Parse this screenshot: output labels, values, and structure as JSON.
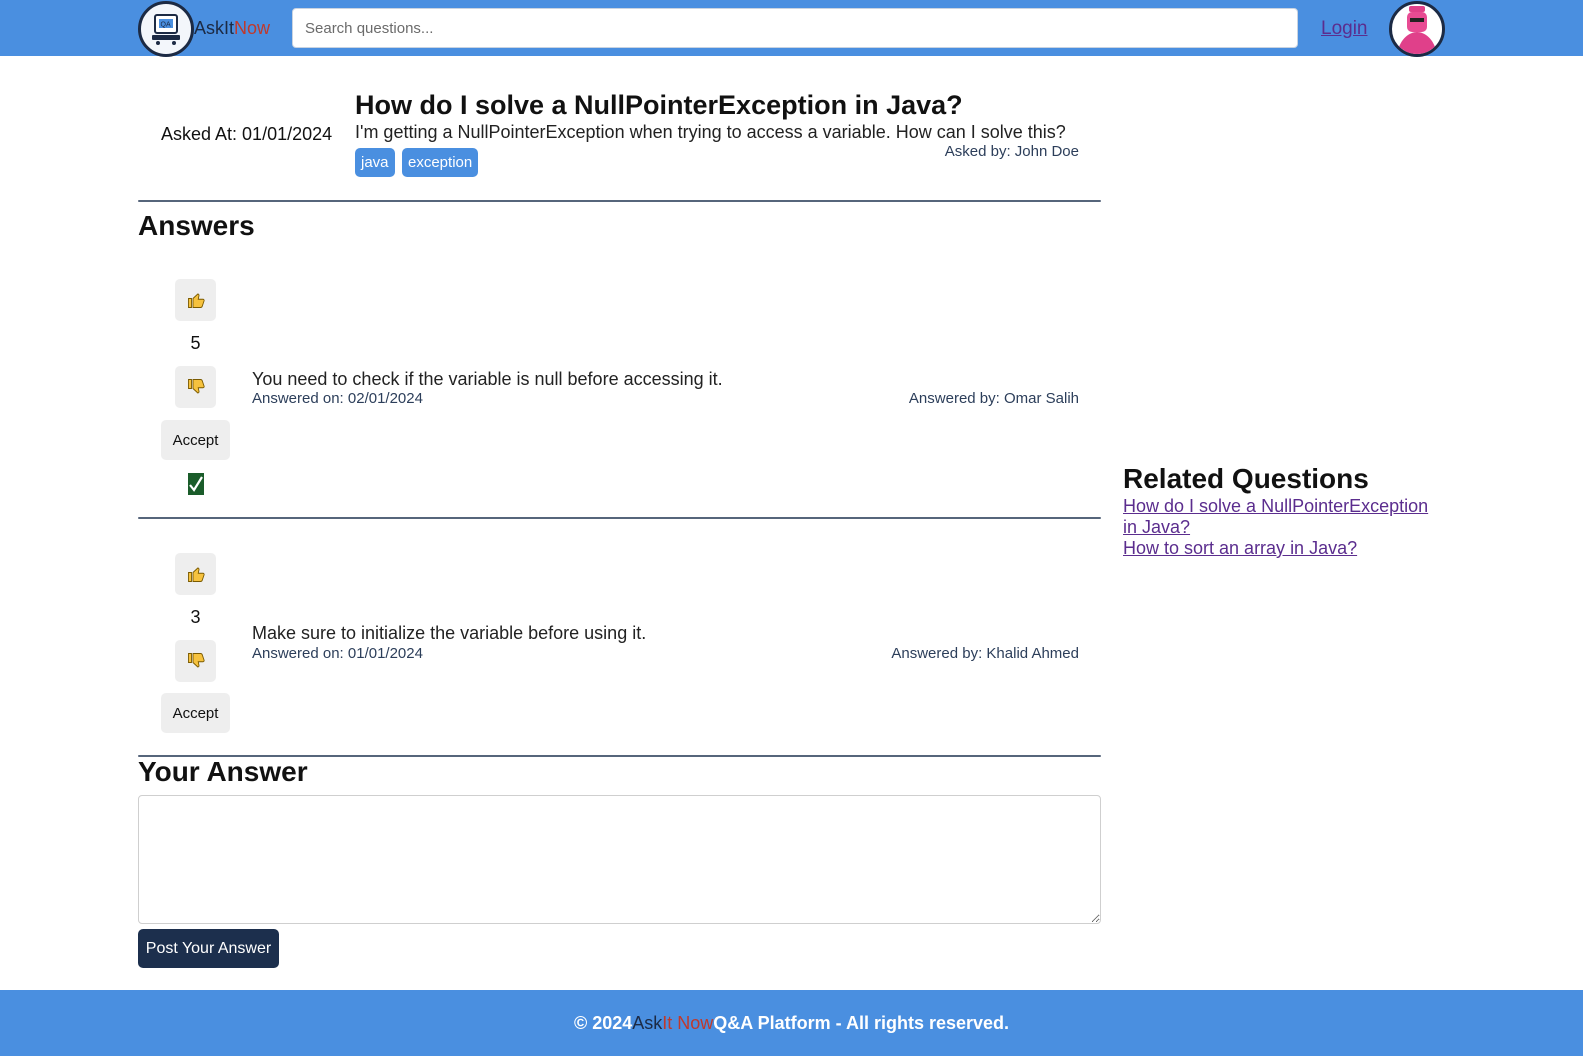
{
  "header": {
    "brand_prefix": "AskIt",
    "brand_accent": "Now",
    "search_placeholder": "Search questions...",
    "login_label": "Login",
    "colors": {
      "bar": "#4a8fe0",
      "brand_dark": "#1c2a44",
      "brand_accent": "#c0392b"
    }
  },
  "question": {
    "asked_at": "Asked At: 01/01/2024",
    "title": "How do I solve a NullPointerException in Java?",
    "body": "I'm getting a NullPointerException when trying to access a variable. How can I solve this?",
    "asked_by": "Asked by: John Doe",
    "tags": [
      "java",
      "exception"
    ]
  },
  "answers_heading": "Answers",
  "answers": [
    {
      "votes": "5",
      "text": "You need to check if the variable is null before accessing it.",
      "answered_on": "Answered on: 02/01/2024",
      "answered_by": "Answered by: Omar Salih",
      "accept_label": "Accept",
      "accepted": true
    },
    {
      "votes": "3",
      "text": "Make sure to initialize the variable before using it.",
      "answered_on": "Answered on: 01/01/2024",
      "answered_by": "Answered by: Khalid Ahmed",
      "accept_label": "Accept",
      "accepted": false
    }
  ],
  "your_answer": {
    "heading": "Your Answer",
    "textarea_value": "",
    "post_label": "Post Your Answer"
  },
  "related": {
    "heading": "Related Questions",
    "links": [
      "How do I solve a NullPointerException in Java?",
      "How to sort an array in Java?"
    ]
  },
  "footer": {
    "prefix": "© 2024 ",
    "ask": "Ask",
    "itnow": " It Now",
    "suffix": " Q&A Platform - All rights reserved."
  }
}
